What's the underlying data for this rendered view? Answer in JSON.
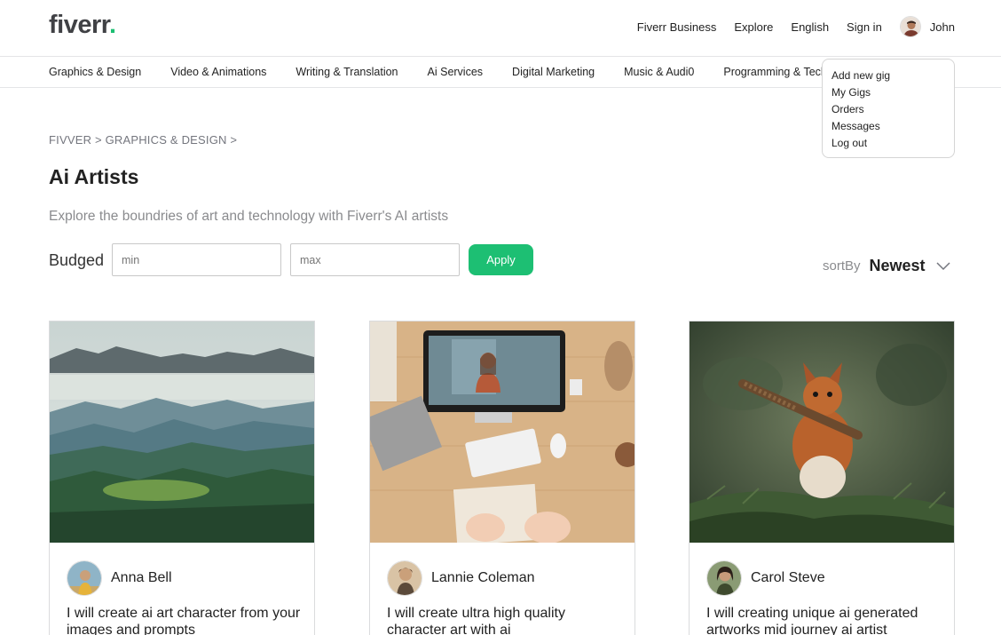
{
  "header": {
    "logo_text": "fiverr",
    "logo_dot": ".",
    "nav": [
      "Fiverr Business",
      "Explore",
      "English",
      "Sign in"
    ],
    "user_name": "John"
  },
  "categories": [
    "Graphics & Design",
    "Video & Animations",
    "Writing & Translation",
    "Ai Services",
    "Digital Marketing",
    "Music & Audi0",
    "Programming & Tech"
  ],
  "user_menu": [
    "Add new gig",
    "My Gigs",
    "Orders",
    "Messages",
    "Log out"
  ],
  "breadcrumb": "FIVVER > GRAPHICS & DESIGN >",
  "page_title": "Ai Artists",
  "subtitle": "Explore the boundries of art and technology with Fiverr's AI artists",
  "filter": {
    "label": "Budged",
    "min_placeholder": "min",
    "max_placeholder": "max",
    "apply_label": "Apply"
  },
  "sort": {
    "label": "sortBy",
    "value": "Newest"
  },
  "cards": [
    {
      "seller": "Anna Bell",
      "title": "I will create ai art character from your images and prompts"
    },
    {
      "seller": "Lannie Coleman",
      "title": "I will create ultra high quality character art with ai"
    },
    {
      "seller": "Carol Steve",
      "title": "I will creating unique ai generated artworks mid journey ai artist"
    }
  ],
  "colors": {
    "brand_green": "#1dbf73",
    "text_dark": "#222222",
    "text_muted": "#8a8b8e"
  }
}
